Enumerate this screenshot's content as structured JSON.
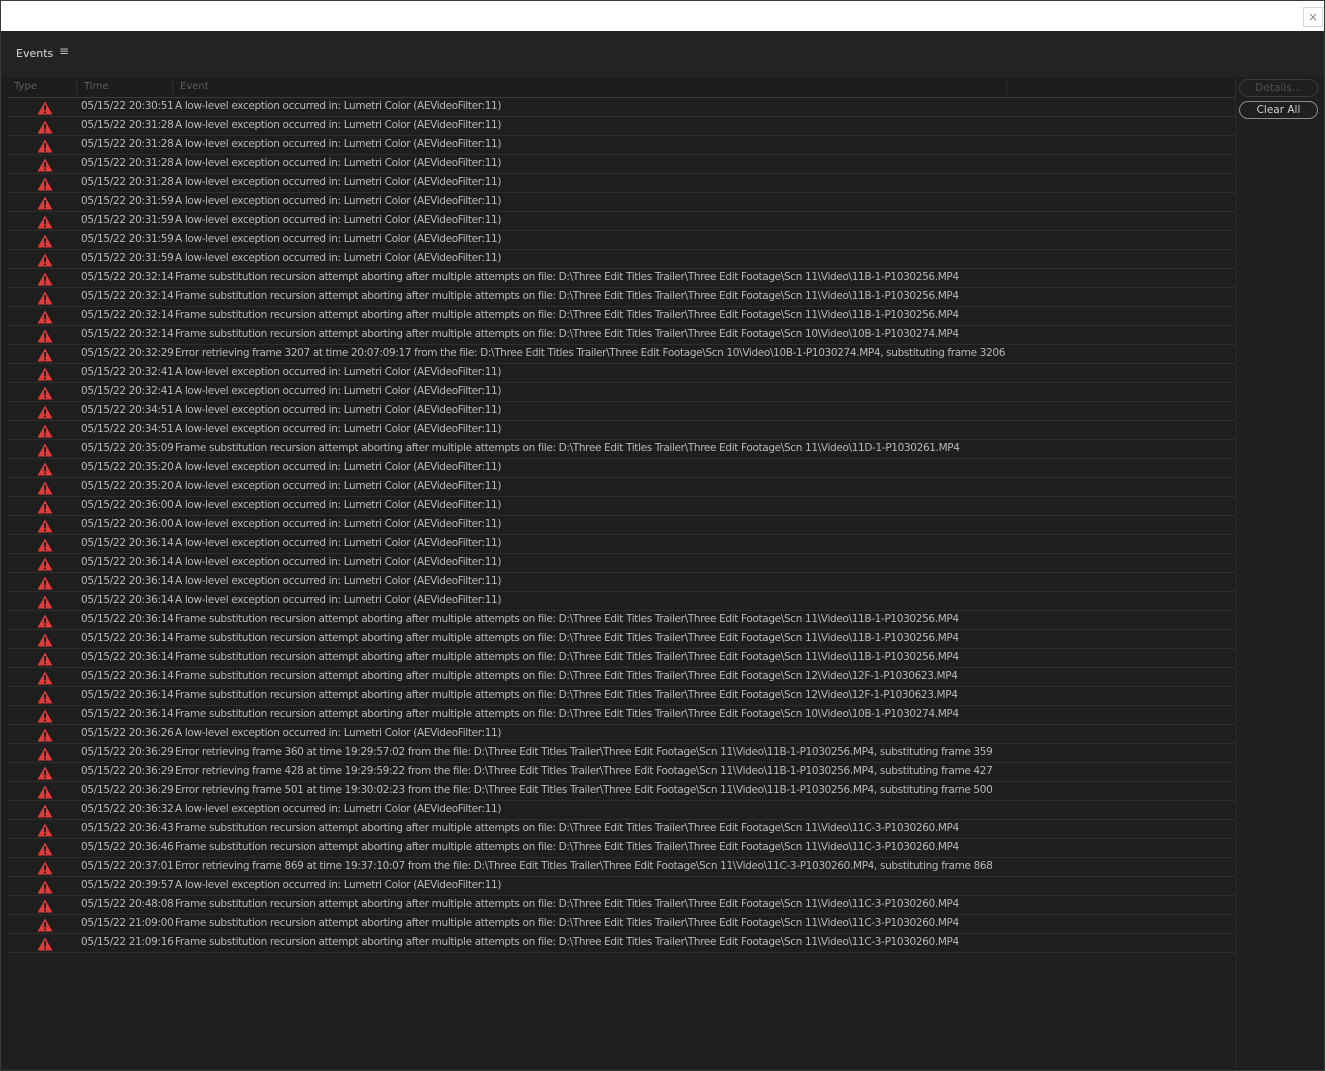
{
  "window": {
    "close_label": "×"
  },
  "panel": {
    "title": "Events",
    "menu_icon": "hamburger-menu-icon",
    "menu_glyph": "≡"
  },
  "columns": {
    "type": "Type",
    "time": "Time",
    "event": "Event"
  },
  "buttons": {
    "details": "Details...",
    "clear_all": "Clear All"
  },
  "colors": {
    "error_icon": "#e03b3b",
    "background": "#1e1e1e",
    "text": "#b8b8b8"
  },
  "rows": [
    {
      "type": "error",
      "time": "05/15/22 20:30:51",
      "event": "A low-level exception occurred in: Lumetri Color (AEVideoFilter:11)"
    },
    {
      "type": "error",
      "time": "05/15/22 20:31:28",
      "event": "A low-level exception occurred in: Lumetri Color (AEVideoFilter:11)"
    },
    {
      "type": "error",
      "time": "05/15/22 20:31:28",
      "event": "A low-level exception occurred in: Lumetri Color (AEVideoFilter:11)"
    },
    {
      "type": "error",
      "time": "05/15/22 20:31:28",
      "event": "A low-level exception occurred in: Lumetri Color (AEVideoFilter:11)"
    },
    {
      "type": "error",
      "time": "05/15/22 20:31:28",
      "event": "A low-level exception occurred in: Lumetri Color (AEVideoFilter:11)"
    },
    {
      "type": "error",
      "time": "05/15/22 20:31:59",
      "event": "A low-level exception occurred in: Lumetri Color (AEVideoFilter:11)"
    },
    {
      "type": "error",
      "time": "05/15/22 20:31:59",
      "event": "A low-level exception occurred in: Lumetri Color (AEVideoFilter:11)"
    },
    {
      "type": "error",
      "time": "05/15/22 20:31:59",
      "event": "A low-level exception occurred in: Lumetri Color (AEVideoFilter:11)"
    },
    {
      "type": "error",
      "time": "05/15/22 20:31:59",
      "event": "A low-level exception occurred in: Lumetri Color (AEVideoFilter:11)"
    },
    {
      "type": "error",
      "time": "05/15/22 20:32:14",
      "event": "Frame substitution recursion attempt aborting after multiple attempts on file: D:\\Three Edit Titles Trailer\\Three Edit Footage\\Scn 11\\Video\\11B-1-P1030256.MP4"
    },
    {
      "type": "error",
      "time": "05/15/22 20:32:14",
      "event": "Frame substitution recursion attempt aborting after multiple attempts on file: D:\\Three Edit Titles Trailer\\Three Edit Footage\\Scn 11\\Video\\11B-1-P1030256.MP4"
    },
    {
      "type": "error",
      "time": "05/15/22 20:32:14",
      "event": "Frame substitution recursion attempt aborting after multiple attempts on file: D:\\Three Edit Titles Trailer\\Three Edit Footage\\Scn 11\\Video\\11B-1-P1030256.MP4"
    },
    {
      "type": "error",
      "time": "05/15/22 20:32:14",
      "event": "Frame substitution recursion attempt aborting after multiple attempts on file: D:\\Three Edit Titles Trailer\\Three Edit Footage\\Scn 10\\Video\\10B-1-P1030274.MP4"
    },
    {
      "type": "error",
      "time": "05/15/22 20:32:29",
      "event": "Error retrieving frame 3207 at time 20:07:09:17 from the file: D:\\Three Edit Titles Trailer\\Three Edit Footage\\Scn 10\\Video\\10B-1-P1030274.MP4, substituting frame 3206"
    },
    {
      "type": "error",
      "time": "05/15/22 20:32:41",
      "event": "A low-level exception occurred in: Lumetri Color (AEVideoFilter:11)"
    },
    {
      "type": "error",
      "time": "05/15/22 20:32:41",
      "event": "A low-level exception occurred in: Lumetri Color (AEVideoFilter:11)"
    },
    {
      "type": "error",
      "time": "05/15/22 20:34:51",
      "event": "A low-level exception occurred in: Lumetri Color (AEVideoFilter:11)"
    },
    {
      "type": "error",
      "time": "05/15/22 20:34:51",
      "event": "A low-level exception occurred in: Lumetri Color (AEVideoFilter:11)"
    },
    {
      "type": "error",
      "time": "05/15/22 20:35:09",
      "event": "Frame substitution recursion attempt aborting after multiple attempts on file: D:\\Three Edit Titles Trailer\\Three Edit Footage\\Scn 11\\Video\\11D-1-P1030261.MP4"
    },
    {
      "type": "error",
      "time": "05/15/22 20:35:20",
      "event": "A low-level exception occurred in: Lumetri Color (AEVideoFilter:11)"
    },
    {
      "type": "error",
      "time": "05/15/22 20:35:20",
      "event": "A low-level exception occurred in: Lumetri Color (AEVideoFilter:11)"
    },
    {
      "type": "error",
      "time": "05/15/22 20:36:00",
      "event": "A low-level exception occurred in: Lumetri Color (AEVideoFilter:11)"
    },
    {
      "type": "error",
      "time": "05/15/22 20:36:00",
      "event": "A low-level exception occurred in: Lumetri Color (AEVideoFilter:11)"
    },
    {
      "type": "error",
      "time": "05/15/22 20:36:14",
      "event": "A low-level exception occurred in: Lumetri Color (AEVideoFilter:11)"
    },
    {
      "type": "error",
      "time": "05/15/22 20:36:14",
      "event": "A low-level exception occurred in: Lumetri Color (AEVideoFilter:11)"
    },
    {
      "type": "error",
      "time": "05/15/22 20:36:14",
      "event": "A low-level exception occurred in: Lumetri Color (AEVideoFilter:11)"
    },
    {
      "type": "error",
      "time": "05/15/22 20:36:14",
      "event": "A low-level exception occurred in: Lumetri Color (AEVideoFilter:11)"
    },
    {
      "type": "error",
      "time": "05/15/22 20:36:14",
      "event": "Frame substitution recursion attempt aborting after multiple attempts on file: D:\\Three Edit Titles Trailer\\Three Edit Footage\\Scn 11\\Video\\11B-1-P1030256.MP4"
    },
    {
      "type": "error",
      "time": "05/15/22 20:36:14",
      "event": "Frame substitution recursion attempt aborting after multiple attempts on file: D:\\Three Edit Titles Trailer\\Three Edit Footage\\Scn 11\\Video\\11B-1-P1030256.MP4"
    },
    {
      "type": "error",
      "time": "05/15/22 20:36:14",
      "event": "Frame substitution recursion attempt aborting after multiple attempts on file: D:\\Three Edit Titles Trailer\\Three Edit Footage\\Scn 11\\Video\\11B-1-P1030256.MP4"
    },
    {
      "type": "error",
      "time": "05/15/22 20:36:14",
      "event": "Frame substitution recursion attempt aborting after multiple attempts on file: D:\\Three Edit Titles Trailer\\Three Edit Footage\\Scn 12\\Video\\12F-1-P1030623.MP4"
    },
    {
      "type": "error",
      "time": "05/15/22 20:36:14",
      "event": "Frame substitution recursion attempt aborting after multiple attempts on file: D:\\Three Edit Titles Trailer\\Three Edit Footage\\Scn 12\\Video\\12F-1-P1030623.MP4"
    },
    {
      "type": "error",
      "time": "05/15/22 20:36:14",
      "event": "Frame substitution recursion attempt aborting after multiple attempts on file: D:\\Three Edit Titles Trailer\\Three Edit Footage\\Scn 10\\Video\\10B-1-P1030274.MP4"
    },
    {
      "type": "error",
      "time": "05/15/22 20:36:26",
      "event": "A low-level exception occurred in: Lumetri Color (AEVideoFilter:11)"
    },
    {
      "type": "error",
      "time": "05/15/22 20:36:29",
      "event": "Error retrieving frame 360 at time 19:29:57:02 from the file: D:\\Three Edit Titles Trailer\\Three Edit Footage\\Scn 11\\Video\\11B-1-P1030256.MP4, substituting frame 359"
    },
    {
      "type": "error",
      "time": "05/15/22 20:36:29",
      "event": "Error retrieving frame 428 at time 19:29:59:22 from the file: D:\\Three Edit Titles Trailer\\Three Edit Footage\\Scn 11\\Video\\11B-1-P1030256.MP4, substituting frame 427"
    },
    {
      "type": "error",
      "time": "05/15/22 20:36:29",
      "event": "Error retrieving frame 501 at time 19:30:02:23 from the file: D:\\Three Edit Titles Trailer\\Three Edit Footage\\Scn 11\\Video\\11B-1-P1030256.MP4, substituting frame 500"
    },
    {
      "type": "error",
      "time": "05/15/22 20:36:32",
      "event": "A low-level exception occurred in: Lumetri Color (AEVideoFilter:11)"
    },
    {
      "type": "error",
      "time": "05/15/22 20:36:43",
      "event": "Frame substitution recursion attempt aborting after multiple attempts on file: D:\\Three Edit Titles Trailer\\Three Edit Footage\\Scn 11\\Video\\11C-3-P1030260.MP4"
    },
    {
      "type": "error",
      "time": "05/15/22 20:36:46",
      "event": "Frame substitution recursion attempt aborting after multiple attempts on file: D:\\Three Edit Titles Trailer\\Three Edit Footage\\Scn 11\\Video\\11C-3-P1030260.MP4"
    },
    {
      "type": "error",
      "time": "05/15/22 20:37:01",
      "event": "Error retrieving frame 869 at time 19:37:10:07 from the file: D:\\Three Edit Titles Trailer\\Three Edit Footage\\Scn 11\\Video\\11C-3-P1030260.MP4, substituting frame 868"
    },
    {
      "type": "error",
      "time": "05/15/22 20:39:57",
      "event": "A low-level exception occurred in: Lumetri Color (AEVideoFilter:11)"
    },
    {
      "type": "error",
      "time": "05/15/22 20:48:08",
      "event": "Frame substitution recursion attempt aborting after multiple attempts on file: D:\\Three Edit Titles Trailer\\Three Edit Footage\\Scn 11\\Video\\11C-3-P1030260.MP4"
    },
    {
      "type": "error",
      "time": "05/15/22 21:09:00",
      "event": "Frame substitution recursion attempt aborting after multiple attempts on file: D:\\Three Edit Titles Trailer\\Three Edit Footage\\Scn 11\\Video\\11C-3-P1030260.MP4"
    },
    {
      "type": "error",
      "time": "05/15/22 21:09:16",
      "event": "Frame substitution recursion attempt aborting after multiple attempts on file: D:\\Three Edit Titles Trailer\\Three Edit Footage\\Scn 11\\Video\\11C-3-P1030260.MP4"
    }
  ]
}
